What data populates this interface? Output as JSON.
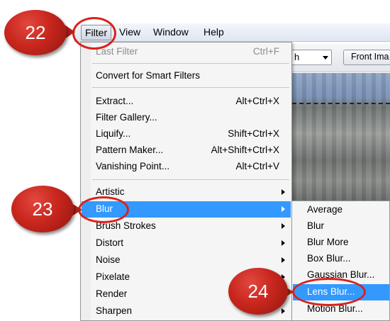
{
  "menubar": {
    "items": [
      {
        "label": "Filter"
      },
      {
        "label": "View"
      },
      {
        "label": "Window"
      },
      {
        "label": "Help"
      }
    ]
  },
  "toolbar": {
    "dropdown_value": "h",
    "front_button": "Front Ima"
  },
  "filter_menu": {
    "items": [
      {
        "label": "Last Filter",
        "shortcut": "Ctrl+F"
      },
      {
        "label": "Convert for Smart Filters",
        "shortcut": ""
      },
      {
        "label": "Extract...",
        "shortcut": "Alt+Ctrl+X"
      },
      {
        "label": "Filter Gallery...",
        "shortcut": ""
      },
      {
        "label": "Liquify...",
        "shortcut": "Shift+Ctrl+X"
      },
      {
        "label": "Pattern Maker...",
        "shortcut": "Alt+Shift+Ctrl+X"
      },
      {
        "label": "Vanishing Point...",
        "shortcut": "Alt+Ctrl+V"
      },
      {
        "label": "Artistic"
      },
      {
        "label": "Blur"
      },
      {
        "label": "Brush Strokes"
      },
      {
        "label": "Distort"
      },
      {
        "label": "Noise"
      },
      {
        "label": "Pixelate"
      },
      {
        "label": "Render"
      },
      {
        "label": "Sharpen"
      }
    ]
  },
  "blur_submenu": {
    "items": [
      {
        "label": "Average"
      },
      {
        "label": "Blur"
      },
      {
        "label": "Blur More"
      },
      {
        "label": "Box Blur..."
      },
      {
        "label": "Gaussian Blur..."
      },
      {
        "label": "Lens Blur..."
      },
      {
        "label": "Motion Blur..."
      }
    ]
  },
  "callouts": [
    {
      "number": "22"
    },
    {
      "number": "23"
    },
    {
      "number": "24"
    }
  ],
  "colors": {
    "highlight": "#3399ff",
    "callout_red": "#c8261d",
    "menu_bg": "#f5f5f5"
  }
}
